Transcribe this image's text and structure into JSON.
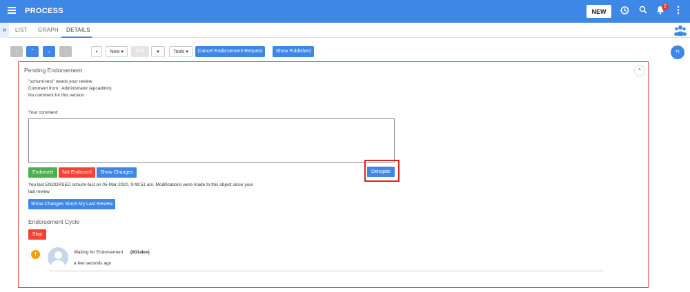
{
  "header": {
    "title": "PROCESS",
    "new_label": "NEW",
    "notification_count": "2",
    "accent": "#3f87e6"
  },
  "tabs": [
    {
      "label": "LIST"
    },
    {
      "label": "GRAPH"
    },
    {
      "label": "DETAILS"
    }
  ],
  "toolbar": {
    "new_label": "New",
    "edit_label": "Edit",
    "tools_label": "Tools",
    "cancel_label": "Cancel Endorsement Request",
    "show_published_label": "Show Published"
  },
  "fab_label": "⇆",
  "panel": {
    "title": "Pending Endorsement",
    "lines": [
      "\"schumi-test\" needs your review",
      "Comment from : Administrator (epcadmin)",
      "No comment for this version"
    ],
    "comment_label": "Your comment:",
    "comment_value": "",
    "endorsed_label": "Endorsed",
    "not_endorsed_label": "Not Endorsed",
    "show_changes_label": "Show Changes",
    "delegate_label": "Delegate",
    "last_review_1": "You last ENDORSED schumi-test on 05-Mar-2020, 9:49:51 am. Modifications were made to this object since your",
    "last_review_2": "last review",
    "show_since_label": "Show Changes Since My Last Review",
    "cycle_title": "Endorsement Cycle",
    "stop_label": "Stop",
    "entry_status": "Waiting for Endorsement",
    "entry_user": "(001alex)",
    "entry_time": "a few seconds ago"
  }
}
